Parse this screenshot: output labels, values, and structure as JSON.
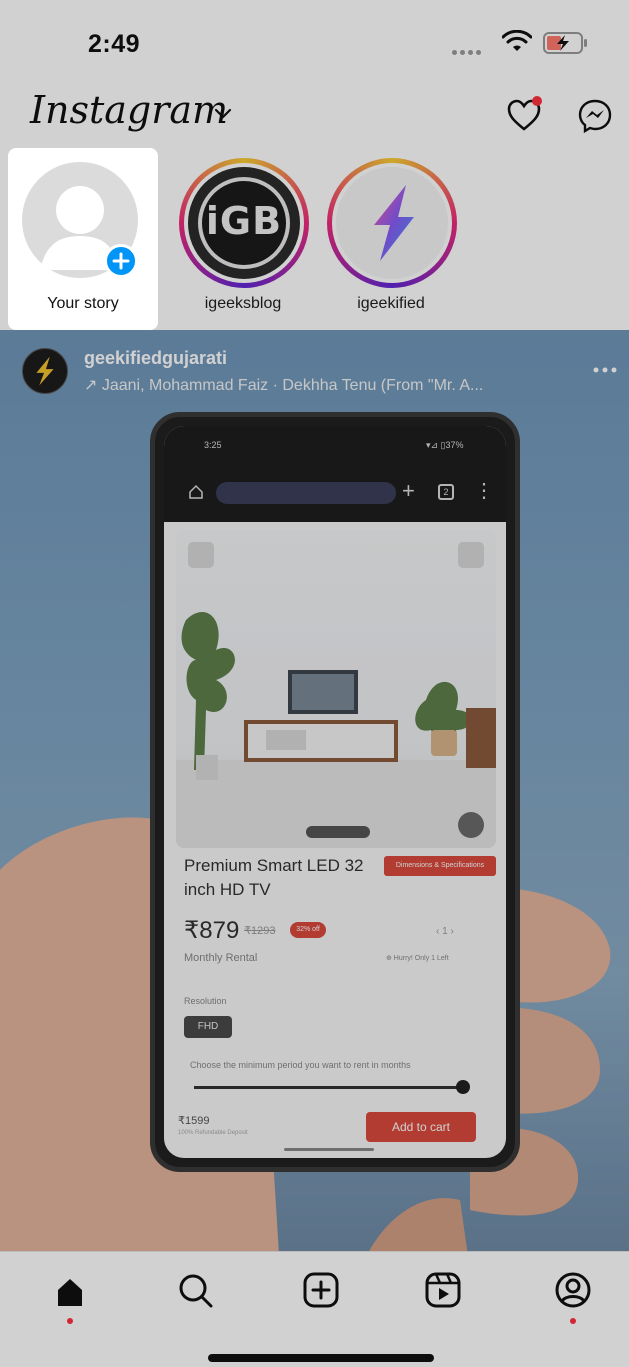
{
  "status_bar": {
    "time": "2:49",
    "signal": "signal-dots-icon",
    "wifi": "wifi-icon",
    "battery": "battery-charging-icon"
  },
  "header": {
    "logo": "Instagram",
    "logo_chevron": "chevron-down-icon",
    "activity_icon": "heart-icon",
    "messages_icon": "messenger-icon"
  },
  "stories": [
    {
      "label": "Your story",
      "type": "own",
      "badge": "plus-icon"
    },
    {
      "label": "igeeksblog",
      "type": "ring",
      "avatar_text": "iGB"
    },
    {
      "label": "igeekified",
      "type": "ring"
    }
  ],
  "post": {
    "username": "geekifiedgujarati",
    "audio": "↗ Jaani, Mohammad Faiz · Dekhha Tenu (From \"Mr. A...",
    "more_icon": "more-horizontal-icon",
    "screenshot": {
      "time": "3:25",
      "status_right": "▾⊿ ▯37%",
      "product_title": "Premium Smart LED 32 inch HD TV",
      "spec_button": "Dimensions & Specifications",
      "price": "₹879",
      "mrp": "₹1293",
      "discount": "32% off",
      "qty": "‹  1  ›",
      "monthly_label": "Monthly Rental",
      "hurry": "⊕ Hurry! Only 1 Left",
      "resolution_label": "Resolution",
      "resolution_value": "FHD",
      "choose_text": "Choose the minimum period you want to rent in months",
      "deposit": "₹1599",
      "deposit_note": "100% Refundable Deposit",
      "add_to_cart": "Add to cart"
    }
  },
  "bottom_nav": [
    {
      "name": "home",
      "icon": "home-icon",
      "active": true
    },
    {
      "name": "search",
      "icon": "search-icon"
    },
    {
      "name": "create",
      "icon": "plus-square-icon"
    },
    {
      "name": "reels",
      "icon": "reels-icon"
    },
    {
      "name": "profile",
      "icon": "profile-icon",
      "badge": true
    }
  ],
  "colors": {
    "accent_blue": "#0095f6",
    "notification_red": "#ff3040",
    "product_red": "#d94a3d"
  }
}
